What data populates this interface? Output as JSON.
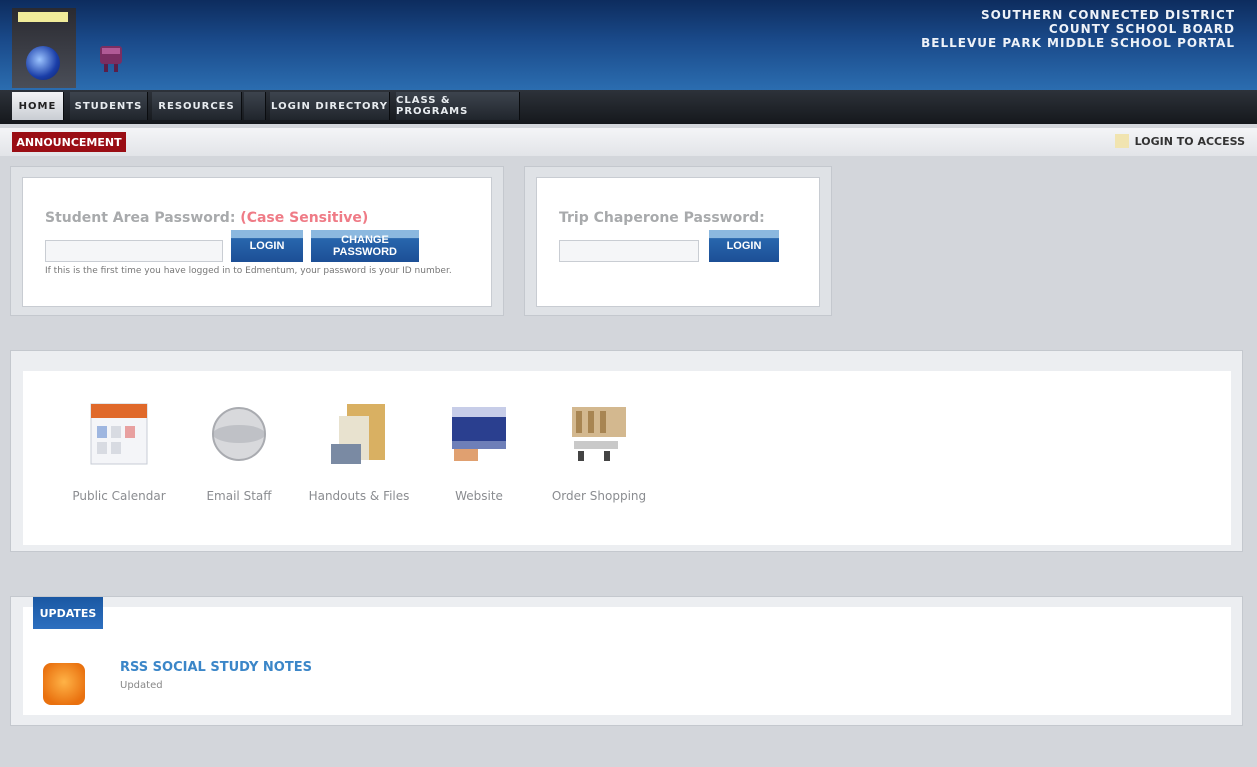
{
  "header": {
    "school_lines": [
      "SOUTHERN CONNECTED DISTRICT",
      "COUNTY SCHOOL BOARD",
      "BELLEVUE PARK MIDDLE SCHOOL PORTAL"
    ],
    "logo_tag": "",
    "brand_icon": "bucket-icon"
  },
  "nav": {
    "tabs": [
      {
        "label": "HOME",
        "active": true
      },
      {
        "label": "STUDENTS",
        "active": false
      },
      {
        "label": "RESOURCES",
        "active": false
      },
      {
        "label": "",
        "active": false
      },
      {
        "label": "LOGIN DIRECTORY",
        "active": false
      },
      {
        "label": "CLASS & PROGRAMS",
        "active": false
      }
    ]
  },
  "status": {
    "alert_label": "ANNOUNCEMENT",
    "right_text": "LOGIN TO ACCESS"
  },
  "student_login": {
    "label": "Student Area Password:",
    "hint": "(Case Sensitive)",
    "input_value": "",
    "input_placeholder": "",
    "submit_label": "LOGIN",
    "secondary_label": "CHANGE PASSWORD",
    "note": "If this is the first time you have logged in to Edmentum, your password is your ID number."
  },
  "chaperone_login": {
    "label": "Trip Chaperone Password:",
    "input_value": "",
    "input_placeholder": "",
    "submit_label": "LOGIN"
  },
  "apps": [
    {
      "icon": "calendar-icon",
      "label": "Public Calendar"
    },
    {
      "icon": "globe-icon",
      "label": "Email Staff"
    },
    {
      "icon": "folder-icon",
      "label": "Handouts & Files"
    },
    {
      "icon": "web-icon",
      "label": "Website"
    },
    {
      "icon": "cart-icon",
      "label": "Order Shopping"
    }
  ],
  "feed": {
    "section_label": "UPDATES",
    "icon": "rss-feed-icon",
    "title": "RSS SOCIAL STUDY NOTES",
    "subtitle": "Updated"
  }
}
